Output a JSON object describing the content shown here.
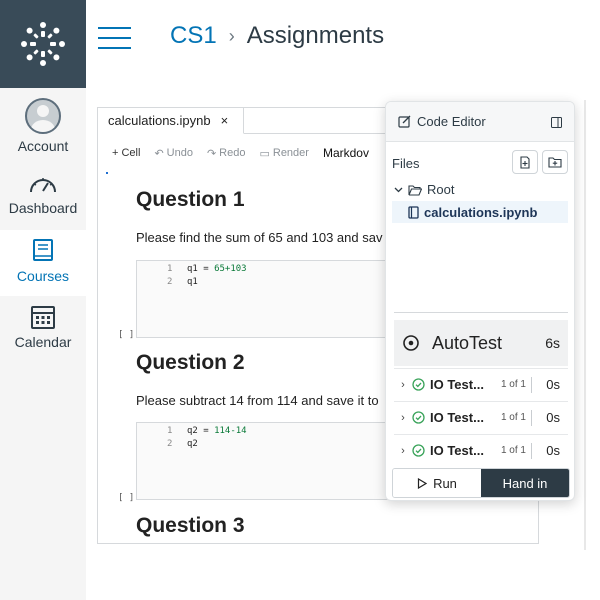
{
  "global_nav": {
    "items": [
      {
        "label": "Account",
        "icon": "user-avatar"
      },
      {
        "label": "Dashboard",
        "icon": "gauge-icon"
      },
      {
        "label": "Courses",
        "icon": "book-icon"
      },
      {
        "label": "Calendar",
        "icon": "calendar-icon"
      }
    ],
    "active_color": "#0374b5",
    "logo_bg": "#394b58"
  },
  "breadcrumb": {
    "course": "CS1",
    "separator": "›",
    "current": "Assignments"
  },
  "notebook": {
    "tab_name": "calculations.ipynb",
    "tab_close": "×",
    "toolbar": {
      "cell": "+ Cell",
      "undo": "Undo",
      "redo": "Redo",
      "render": "Render",
      "markdown": "Markdov"
    },
    "q1": {
      "title": "Question 1",
      "text": "Please find the sum of 65 and 103 and sav",
      "lines": [
        {
          "n": "1",
          "pre": "q1 = ",
          "num": "65+103"
        },
        {
          "n": "2",
          "pre": "q1",
          "num": ""
        }
      ],
      "prompt": "[ ]"
    },
    "q2": {
      "title": "Question 2",
      "text": "Please subtract 14 from 114 and save it to",
      "lines": [
        {
          "n": "1",
          "pre": "q2 = ",
          "num": "114-14"
        },
        {
          "n": "2",
          "pre": "q2",
          "num": ""
        }
      ],
      "prompt": "[ ]"
    },
    "q3": {
      "title": "Question 3"
    }
  },
  "code_editor": {
    "title": "Code Editor",
    "files_label": "Files",
    "root": "Root",
    "file": "calculations.ipynb",
    "autotest": {
      "label": "AutoTest",
      "duration": "6s",
      "tests": [
        {
          "name": "IO Test...",
          "count": "1 of 1",
          "time": "0s"
        },
        {
          "name": "IO Test...",
          "count": "1 of 1",
          "time": "0s"
        },
        {
          "name": "IO Test...",
          "count": "1 of 1",
          "time": "0s"
        }
      ],
      "pass_color": "#3aa35a"
    },
    "run_label": "Run",
    "handin_label": "Hand in"
  }
}
